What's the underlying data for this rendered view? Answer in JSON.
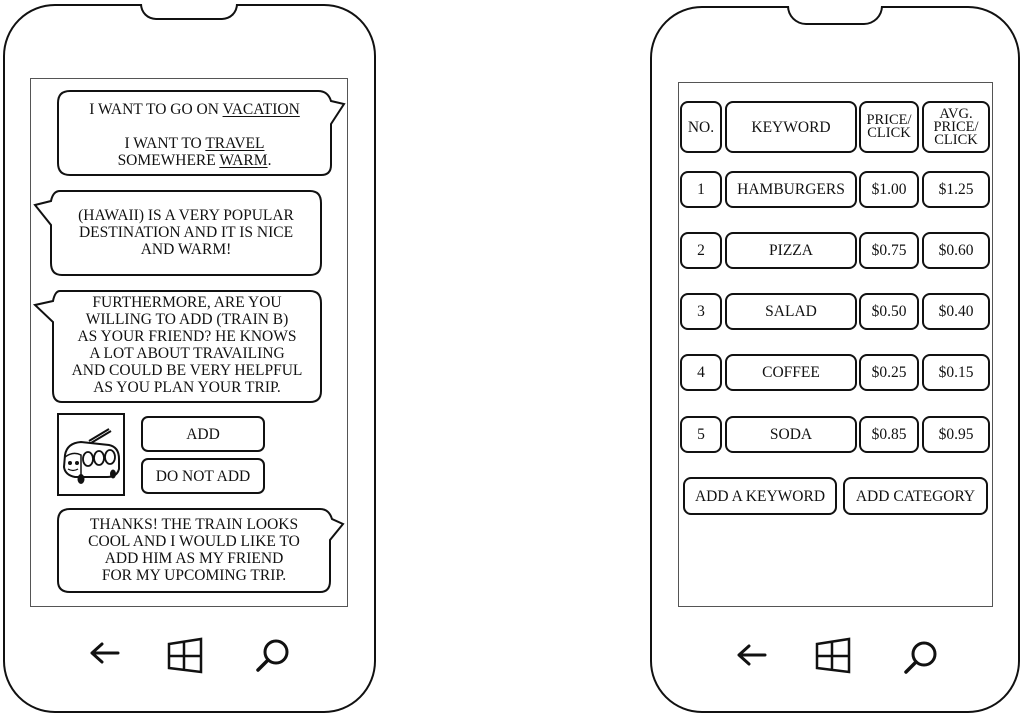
{
  "left_phone": {
    "chat": {
      "messages": [
        {
          "sender": "user",
          "side": "right",
          "line1_prefix": "I WANT TO GO ON ",
          "line1_link": "VACATION",
          "line2_prefix": "I WANT TO ",
          "line2_link": "TRAVEL",
          "line3_prefix": "SOMEWHERE ",
          "line3_link": "WARM",
          "line3_suffix": "."
        },
        {
          "sender": "bot",
          "side": "left",
          "lines": [
            "(HAWAII) IS A VERY POPULAR",
            "DESTINATION  AND IT IS NICE",
            "AND WARM!"
          ]
        },
        {
          "sender": "bot",
          "side": "left",
          "lines": [
            "FURTHERMORE, ARE YOU",
            "WILLING TO ADD (TRAIN B)",
            "AS YOUR  FRIEND? HE KNOWS",
            "A LOT ABOUT  TRAVAILING",
            "AND COULD BE VERY HELPFUL",
            "AS YOU PLAN YOUR TRIP."
          ]
        },
        {
          "sender": "user",
          "side": "right",
          "lines": [
            "THANKS! THE TRAIN LOOKS",
            "COOL AND I WOULD LIKE TO",
            "ADD HIM AS MY FRIEND",
            "FOR MY UPCOMING TRIP."
          ]
        }
      ],
      "friend_card": {
        "image": "train-character-icon",
        "add_label": "ADD",
        "do_not_add_label": "DO NOT ADD"
      }
    },
    "nav": {
      "back": "back-arrow-icon",
      "home": "windows-logo-icon",
      "search": "search-icon"
    }
  },
  "right_phone": {
    "table": {
      "headers": {
        "no": "NO.",
        "keyword": "KEYWORD",
        "price_line1": "PRICE/",
        "price_line2": "CLICK",
        "avg_line1": "AVG.",
        "avg_line2": "PRICE/",
        "avg_line3": "CLICK"
      },
      "rows": [
        {
          "no": "1",
          "keyword": "HAMBURGERS",
          "price": "$1.00",
          "avg": "$1.25"
        },
        {
          "no": "2",
          "keyword": "PIZZA",
          "price": "$0.75",
          "avg": "$0.60"
        },
        {
          "no": "3",
          "keyword": "SALAD",
          "price": "$0.50",
          "avg": "$0.40"
        },
        {
          "no": "4",
          "keyword": "COFFEE",
          "price": "$0.25",
          "avg": "$0.15"
        },
        {
          "no": "5",
          "keyword": "SODA",
          "price": "$0.85",
          "avg": "$0.95"
        }
      ]
    },
    "buttons": {
      "add_keyword": "ADD A KEYWORD",
      "add_category": "ADD CATEGORY"
    },
    "nav": {
      "back": "back-arrow-icon",
      "home": "windows-logo-icon",
      "search": "search-icon"
    }
  }
}
